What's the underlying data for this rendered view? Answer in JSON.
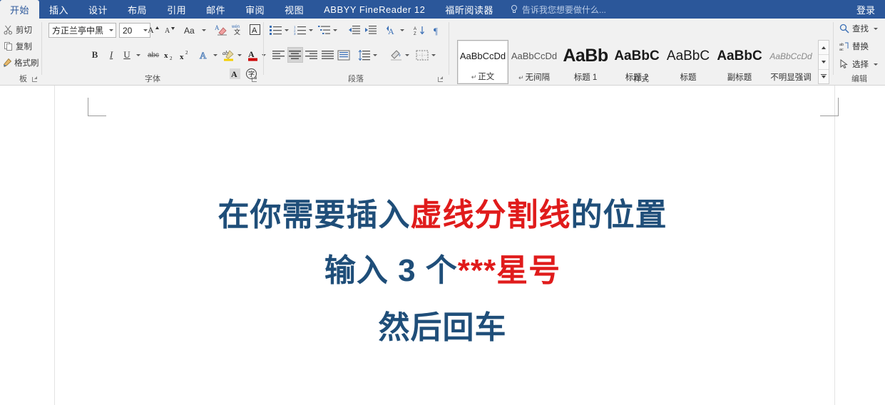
{
  "app": {
    "ribbon_tabs": [
      {
        "label": "开始",
        "active": true
      },
      {
        "label": "插入",
        "active": false
      },
      {
        "label": "设计",
        "active": false
      },
      {
        "label": "布局",
        "active": false
      },
      {
        "label": "引用",
        "active": false
      },
      {
        "label": "邮件",
        "active": false
      },
      {
        "label": "审阅",
        "active": false
      },
      {
        "label": "视图",
        "active": false
      },
      {
        "label": "ABBYY FineReader 12",
        "active": false
      },
      {
        "label": "福昕阅读器",
        "active": false
      }
    ],
    "tell_me_placeholder": "告诉我您想要做什么...",
    "signin_label": "登录"
  },
  "ribbon": {
    "clipboard": {
      "group_label": "板",
      "cut_label": "剪切",
      "copy_label": "复制",
      "format_painter_label": "格式刷"
    },
    "font": {
      "group_label": "字体",
      "font_name": "方正兰亭中黑",
      "font_size": "20",
      "grow_label": "A",
      "shrink_label": "A",
      "case_label": "Aa",
      "clear_label": "clear-formatting",
      "phonetic_label": "文",
      "border_label": "A",
      "bold_label": "B",
      "italic_label": "I",
      "underline_label": "U",
      "strike_label": "abc",
      "subscript_label": "x",
      "superscript_label": "x",
      "effects_label": "A",
      "highlight_label": "ab",
      "color_label": "A",
      "shading_label": "A",
      "enclose_label": "字"
    },
    "paragraph": {
      "group_label": "段落",
      "bullets_label": "bullets",
      "numbering_label": "numbering",
      "multilevel_label": "multilevel-list",
      "dec_indent_label": "decrease-indent",
      "inc_indent_label": "increase-indent",
      "asian_layout_label": "A",
      "sort_label": "sort",
      "marks_label": "show-marks",
      "align_left_label": "align-left",
      "align_center_label": "align-center",
      "align_right_label": "align-right",
      "align_justify_label": "align-justify",
      "align_distribute_label": "align-distributed",
      "line_spacing_label": "line-spacing",
      "shading_label": "shading",
      "borders_label": "borders"
    },
    "styles": {
      "group_label": "样式",
      "items": [
        {
          "preview": "AaBbCcDd",
          "name": "正文",
          "mark": "↵",
          "selected": true
        },
        {
          "preview": "AaBbCcDd",
          "name": "无间隔",
          "mark": "↵",
          "selected": false
        },
        {
          "preview": "AaBb",
          "name": "标题 1",
          "mark": "",
          "selected": false
        },
        {
          "preview": "AaBbC",
          "name": "标题 2",
          "mark": "",
          "selected": false
        },
        {
          "preview": "AaBbC",
          "name": "标题",
          "mark": "",
          "selected": false
        },
        {
          "preview": "AaBbC",
          "name": "副标题",
          "mark": "",
          "selected": false
        },
        {
          "preview": "AaBbCcDd",
          "name": "不明显强调",
          "mark": "",
          "selected": false
        }
      ]
    },
    "editing": {
      "group_label": "编辑",
      "find_label": "查找",
      "replace_label": "替换",
      "select_label": "选择"
    }
  },
  "document": {
    "lines": [
      {
        "segments": [
          {
            "text": "在你需要插入",
            "color": "blue"
          },
          {
            "text": "虚线分割线",
            "color": "red"
          },
          {
            "text": "的位置",
            "color": "blue"
          }
        ]
      },
      {
        "segments": [
          {
            "text": "输入 3 个",
            "color": "blue"
          },
          {
            "text": "***星号",
            "color": "red"
          }
        ]
      },
      {
        "segments": [
          {
            "text": "然后回车",
            "color": "blue"
          }
        ]
      }
    ]
  },
  "colors": {
    "ribbon_accent": "#2b579a",
    "ribbon_bg": "#f1f1f1",
    "text_blue": "#1f4e79",
    "text_red": "#e01b1b"
  }
}
